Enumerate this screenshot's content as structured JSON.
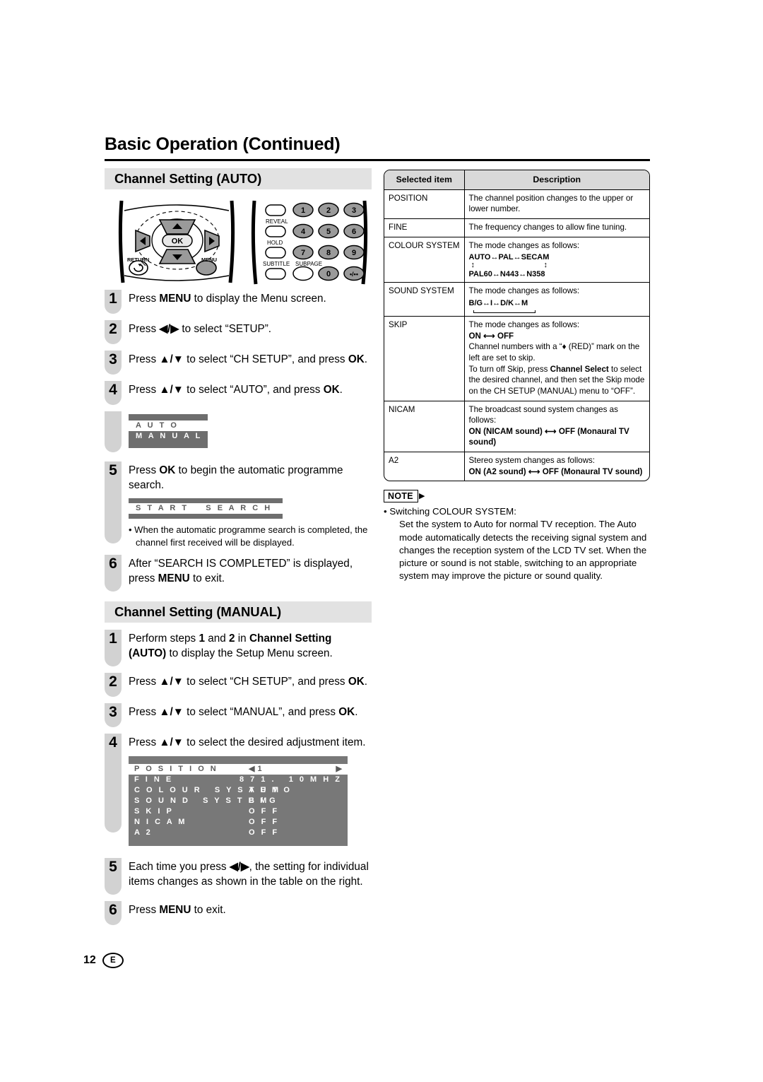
{
  "header": {
    "title": "Basic Operation (Continued)"
  },
  "footer": {
    "page_number": "12",
    "region_mark": "E"
  },
  "sections": {
    "auto": {
      "heading": "Channel Setting (AUTO)",
      "steps": [
        {
          "num": "1",
          "text": "Press MENU to display the Menu screen."
        },
        {
          "num": "2",
          "text": "Press ◀/▶ to select “SETUP”."
        },
        {
          "num": "3",
          "text": "Press ▲/▼ to select “CH SETUP”, and press OK."
        },
        {
          "num": "4",
          "text": "Press ▲/▼ to select “AUTO”, and press OK."
        },
        {
          "num": "5",
          "text": "Press OK to begin the automatic programme search."
        },
        {
          "num": "6",
          "text": "After “SEARCH IS COMPLETED” is displayed, press MENU to exit."
        }
      ],
      "osd_auto_manual": {
        "selected": "A U T O",
        "other": "M A N U A L"
      },
      "osd_start_search": {
        "line": "S T A R T    S E A R C H"
      },
      "bullet": "When the automatic programme search is completed, the channel first received will be displayed."
    },
    "manual": {
      "heading": "Channel Setting (MANUAL)",
      "steps": [
        {
          "num": "1",
          "text": "Perform steps 1 and 2 in Channel Setting (AUTO) to display the Setup Menu screen."
        },
        {
          "num": "2",
          "text": "Press ▲/▼ to select “CH SETUP”, and press OK."
        },
        {
          "num": "3",
          "text": "Press ▲/▼ to select “MANUAL”, and press OK."
        },
        {
          "num": "4",
          "text": "Press ▲/▼ to select the desired adjustment item."
        },
        {
          "num": "5",
          "text": "Each time you press ◀/▶, the setting for individual items changes as shown in the table on the right."
        },
        {
          "num": "6",
          "text": "Press MENU to exit."
        }
      ],
      "osd_menu": {
        "rows": [
          {
            "label": "P O S I T I O N",
            "value": "1",
            "selected": true,
            "arrows": true
          },
          {
            "label": "F I N E",
            "value": "8 7 1 .   1 0 M H Z",
            "selected": false,
            "arrows": false
          },
          {
            "label": "C O L O U R   S Y S T E M",
            "value": "A U T O",
            "selected": false,
            "arrows": false
          },
          {
            "label": "S O U N D   S Y S T E M",
            "value": "B / G",
            "selected": false,
            "arrows": false
          },
          {
            "label": "S K I P",
            "value": "O F F",
            "selected": false,
            "arrows": false
          },
          {
            "label": "N I C A M",
            "value": "O F F",
            "selected": false,
            "arrows": false
          },
          {
            "label": "A 2",
            "value": "O F F",
            "selected": false,
            "arrows": false
          }
        ]
      }
    }
  },
  "remote": {
    "labels": {
      "return": "RETURN",
      "menu": "MENU",
      "ok": "OK",
      "reveal": "REVEAL",
      "hold": "HOLD",
      "subtitle": "SUBTITLE",
      "subpage": "SUBPAGE"
    },
    "keys": [
      "1",
      "2",
      "3",
      "4",
      "5",
      "6",
      "7",
      "8",
      "9",
      "0"
    ],
    "last_key": "•/••"
  },
  "table": {
    "headers": [
      "Selected item",
      "Description"
    ],
    "rows": [
      {
        "item": "POSITION",
        "lines": [
          "The channel position changes to the upper or lower number."
        ],
        "diagram": null
      },
      {
        "item": "FINE",
        "lines": [
          "The frequency changes to allow fine tuning."
        ],
        "diagram": null
      },
      {
        "item": "COLOUR SYSTEM",
        "lines": [
          "The mode changes as follows:"
        ],
        "diagram": {
          "type": "colour",
          "top": "AUTO↔PAL↔SECAM",
          "bottom": "PAL60↔N443↔N358"
        }
      },
      {
        "item": "SOUND SYSTEM",
        "lines": [
          "The mode changes as follows:"
        ],
        "diagram": {
          "type": "sound",
          "top": "B/G↔I↔D/K↔M"
        }
      },
      {
        "item": "SKIP",
        "lines": [
          "The mode changes as follows:",
          "ON ⟷ OFF",
          "Channel numbers with a “♦ (RED)” mark on the left are set to skip.",
          "To turn off Skip, press Channel Select to select the desired channel, and then set the Skip mode on the CH SETUP (MANUAL) menu to “OFF”."
        ],
        "diagram": null
      },
      {
        "item": "NICAM",
        "lines": [
          "The broadcast sound system changes as follows:",
          "ON (NICAM sound) ⟷ OFF (Monaural TV sound)"
        ],
        "diagram": null
      },
      {
        "item": "A2",
        "lines": [
          "Stereo system changes as follows:",
          "ON (A2 sound) ⟷ OFF (Monaural TV sound)"
        ],
        "diagram": null
      }
    ]
  },
  "note": {
    "tag": "NOTE",
    "bullet_title": "Switching COLOUR SYSTEM:",
    "body": "Set the system to Auto for normal TV reception. The Auto mode automatically detects the receiving signal system and changes the reception system of the LCD TV set. When the picture or sound is not stable, switching to an appropriate system may improve the picture or sound quality."
  },
  "colors": {
    "section_bar": "#e2e2e2",
    "step_badge": "#d2d2d2",
    "osd_bg": "#6e6e6e",
    "table_header": "#d9d9d9"
  }
}
